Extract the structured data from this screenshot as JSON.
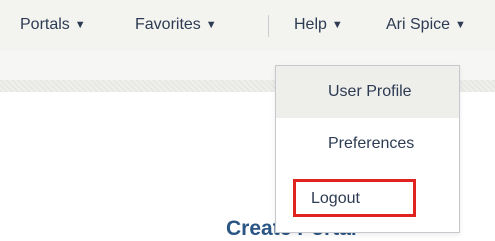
{
  "nav": {
    "portals_label": "Portals",
    "favorites_label": "Favorites",
    "help_label": "Help",
    "user_label": "Ari Spice"
  },
  "user_menu": {
    "items": [
      {
        "label": "User Profile"
      },
      {
        "label": "Preferences"
      },
      {
        "label": "Logout"
      }
    ]
  },
  "page": {
    "title_partial": "Create Portal"
  },
  "colors": {
    "nav_text": "#2d3b52",
    "title": "#2a5585",
    "highlight": "#e0231f"
  }
}
